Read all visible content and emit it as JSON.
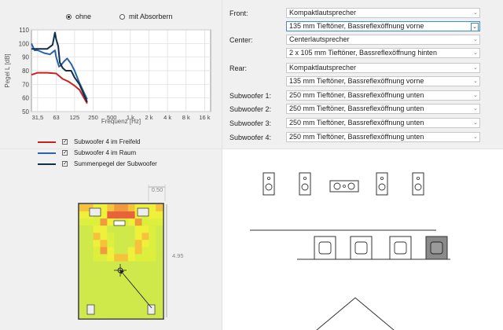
{
  "radio_options": [
    {
      "label": "ohne",
      "selected": true
    },
    {
      "label": "mit Absorbern",
      "selected": false
    }
  ],
  "colors": {
    "freifeld": "#cc2020",
    "raum": "#2a64a8",
    "summe": "#102e4a"
  },
  "chart_data": {
    "type": "line",
    "xlabel": "Frequenz [Hz]",
    "ylabel": "Pegel L [dB]",
    "x_ticks": [
      "31,5",
      "63",
      "125",
      "250",
      "500",
      "1 k",
      "2 k",
      "4 k",
      "8 k",
      "16 k"
    ],
    "y_ticks": [
      110,
      100,
      90,
      80,
      70,
      60,
      50
    ],
    "ylim": [
      50,
      110
    ],
    "x_scale": "log",
    "grid": true,
    "series": [
      {
        "name": "Subwoofer 4 im Freifeld",
        "x": [
          25,
          31.5,
          45,
          63,
          80,
          100,
          125,
          150,
          200
        ],
        "y": [
          77,
          78.5,
          78.5,
          78,
          74,
          72,
          69,
          66,
          56
        ]
      },
      {
        "name": "Subwoofer 4 im Raum",
        "x": [
          25,
          28,
          31.5,
          40,
          50,
          60,
          63,
          70,
          75,
          85,
          95,
          110,
          125,
          150,
          200
        ],
        "y": [
          100,
          95,
          95,
          93,
          92,
          95,
          90,
          83,
          84,
          87,
          89,
          85,
          80,
          71,
          59
        ]
      },
      {
        "name": "Summenpegel der Subwoofer",
        "x": [
          25,
          31.5,
          45,
          55,
          60,
          63,
          68,
          72,
          80,
          90,
          110,
          125,
          150,
          200
        ],
        "y": [
          96,
          96,
          96,
          99,
          108,
          103,
          98,
          86,
          82,
          80,
          80,
          75,
          70,
          57
        ]
      }
    ]
  },
  "legend": [
    {
      "label": "Subwoofer 4 im Freifeld",
      "checked": true
    },
    {
      "label": "Subwoofer 4 im Raum",
      "checked": true
    },
    {
      "label": "Summenpegel der Subwoofer",
      "checked": true
    }
  ],
  "speaker_rows": [
    {
      "label": "Front:",
      "options": [
        "Kompaktlautsprecher",
        "135 mm Tieftöner, Bassreflexöffnung vorne"
      ]
    },
    {
      "label": "Center:",
      "options": [
        "Centerlautsprecher",
        "2 x 105 mm Tieftöner, Bassreflexöffnung hinten"
      ]
    },
    {
      "label": "Rear:",
      "options": [
        "Kompaktlautsprecher",
        "135 mm Tieftöner, Bassreflexöffnung vorne"
      ]
    },
    {
      "label": "Subwoofer 1:",
      "options": [
        "250 mm Tieftöner, Bassreflexöffnung unten"
      ]
    },
    {
      "label": "Subwoofer 2:",
      "options": [
        "250 mm Tieftöner, Bassreflexöffnung unten"
      ]
    },
    {
      "label": "Subwoofer 3:",
      "options": [
        "250 mm Tieftöner, Bassreflexöffnung unten"
      ]
    },
    {
      "label": "Subwoofer 4:",
      "options": [
        "250 mm Tieftöner, Bassreflexöffnung unten"
      ]
    }
  ],
  "room_plan": {
    "dim_top": "0.50",
    "dim_side": "4.95"
  }
}
